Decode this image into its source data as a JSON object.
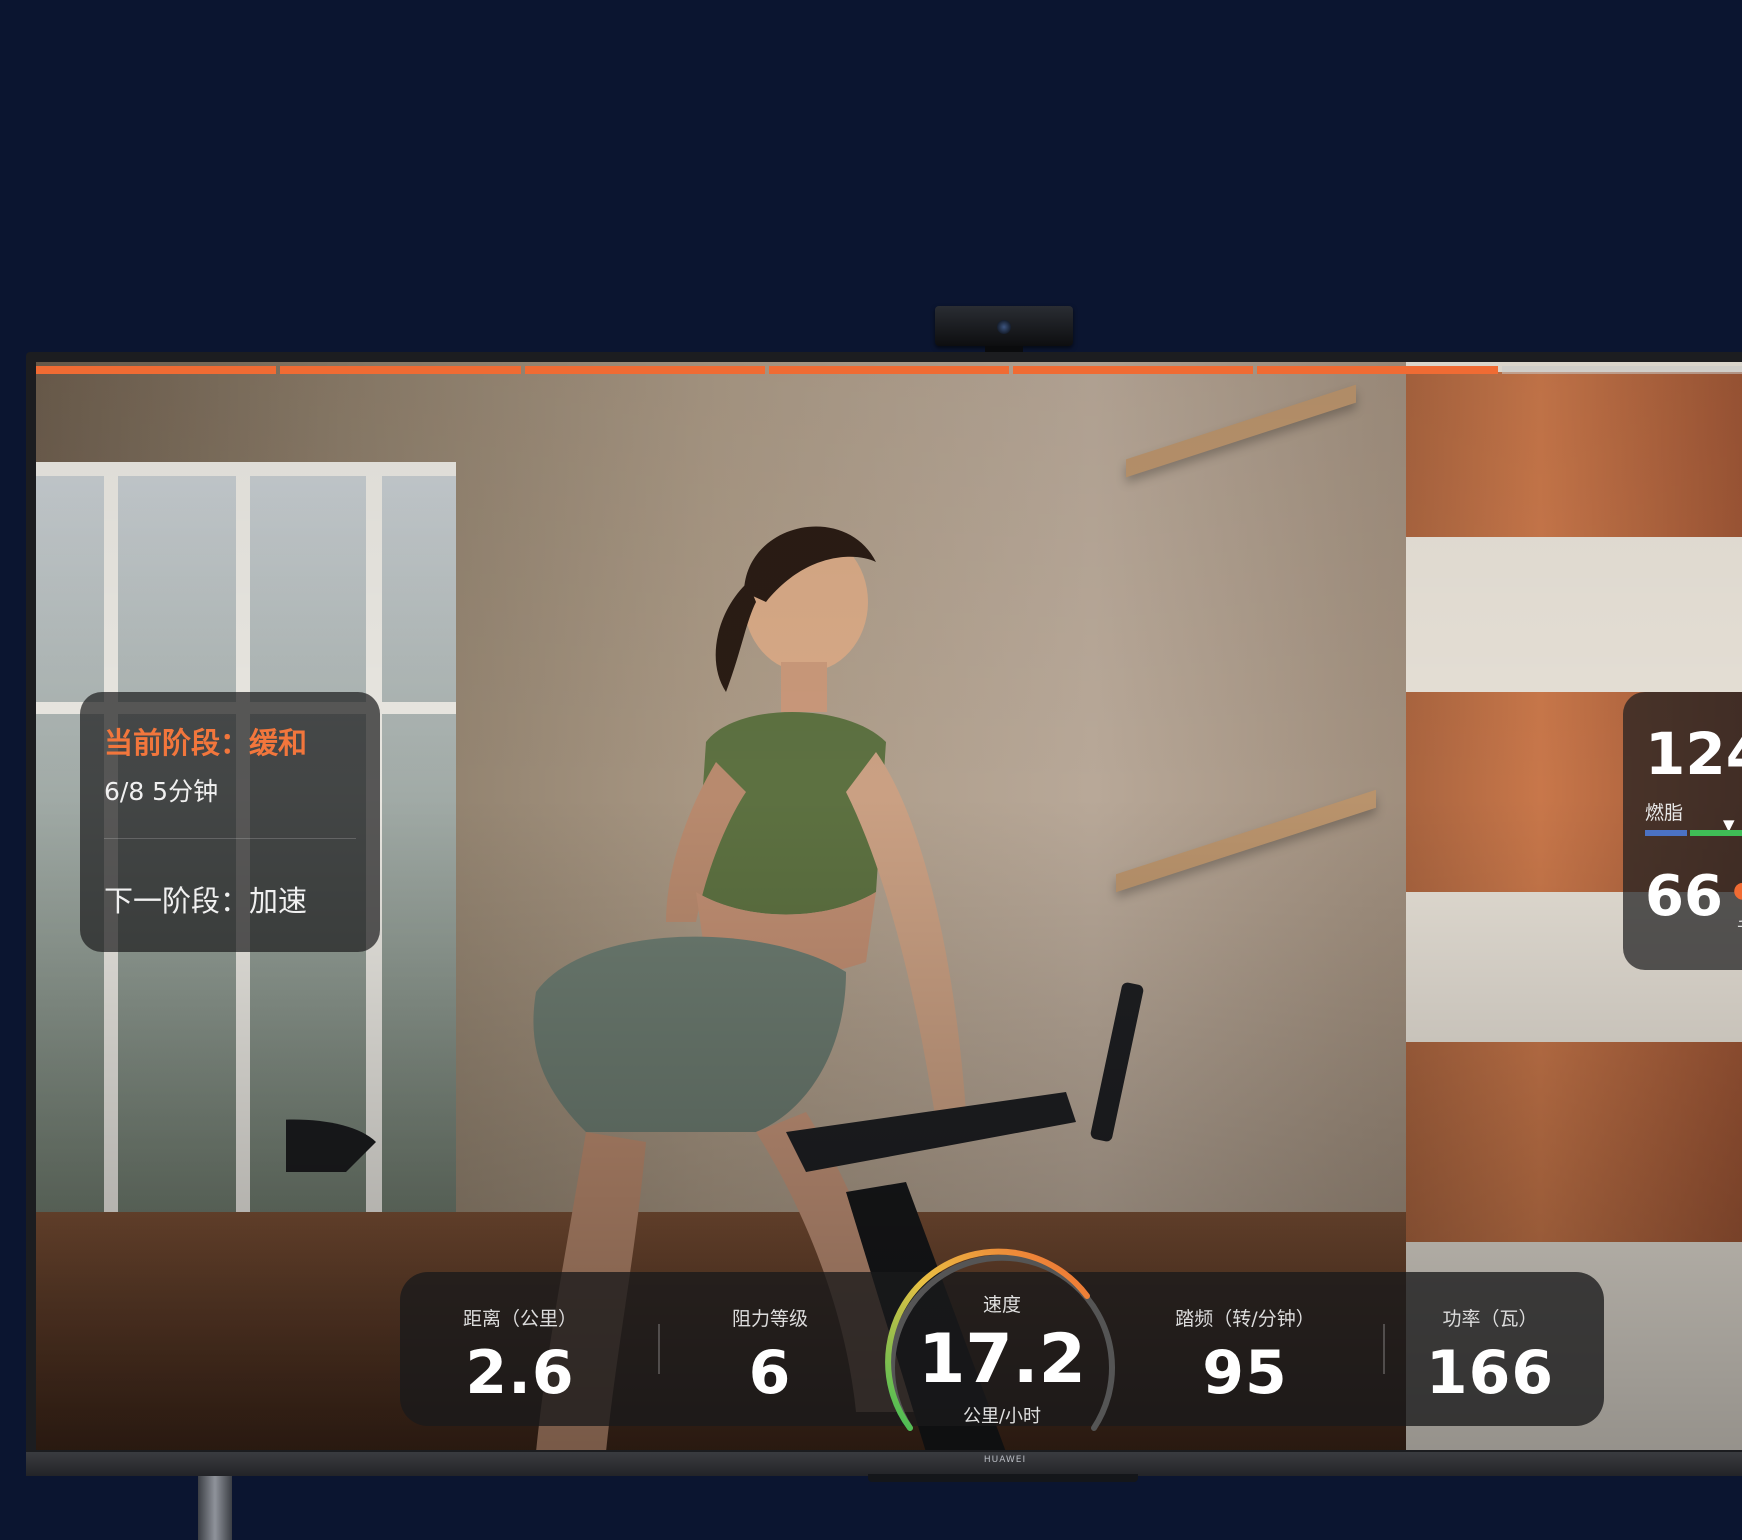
{
  "tv": {
    "brand": "HUAWEI"
  },
  "progress": {
    "segments": 7,
    "completed": 6
  },
  "phase_panel": {
    "current_phase": "当前阶段：缓和",
    "progress_text": "6/8  5分钟",
    "next_phase": "下一阶段：加速"
  },
  "heart_panel": {
    "heart_rate": "124",
    "zone": "燃脂",
    "calories": "66",
    "calories_unit": "千"
  },
  "metrics": {
    "distance": {
      "label": "距离（公里）",
      "value": "2.6"
    },
    "resistance": {
      "label": "阻力等级",
      "value": "6"
    },
    "speed": {
      "label": "速度",
      "value": "17.2",
      "unit": "公里/小时"
    },
    "cadence": {
      "label": "踏频（转/分钟）",
      "value": "95"
    },
    "power": {
      "label": "功率（瓦）",
      "value": "166"
    }
  },
  "colors": {
    "accent": "#f06b33",
    "panel_bg": "rgba(30,30,32,0.72)",
    "zone_blue": "#4b72c4",
    "zone_green": "#3fbd56"
  }
}
